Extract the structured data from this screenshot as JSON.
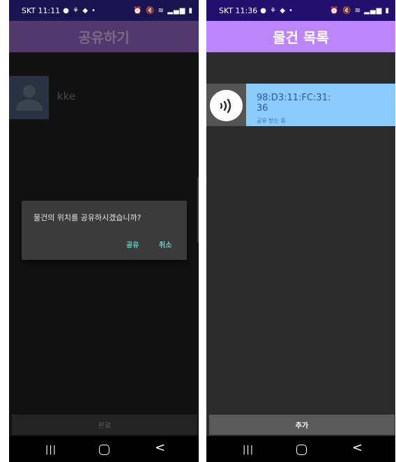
{
  "left_screen": {
    "status_bar": {
      "time": "SKT 11:11",
      "notif_icons": "● ⚘ ◆ •",
      "right_icons": "⏰ 🔇 ≋ ▂▄▆ ▮"
    },
    "app_bar": {
      "title": "공유하기"
    },
    "contact": {
      "name": "kke"
    },
    "dialog": {
      "message": "물건의 위치를 공유하시겠습니까?",
      "confirm_label": "공유",
      "cancel_label": "취소"
    },
    "done_button": {
      "label": "완료"
    },
    "nav": {
      "recent": "|||",
      "back": "<"
    }
  },
  "right_screen": {
    "status_bar": {
      "time": "SKT 11:36",
      "notif_icons": "● ⚘ ◆ •",
      "right_icons": "⏰ 🔇 ≋ ▂▄▆ ▮"
    },
    "app_bar": {
      "title": "물건 목록"
    },
    "items": [
      {
        "mac": "98:D3:11:FC:31:36",
        "status": "공유 받는 중",
        "icon": "nfc-signal-icon"
      }
    ],
    "add_button": {
      "label": "추가"
    },
    "nav": {
      "recent": "|||",
      "back": "<"
    }
  },
  "colors": {
    "accent_purple": "#bb86fc",
    "item_highlight": "#8bccfd",
    "dialog_button_teal": "#5fd6c8"
  }
}
